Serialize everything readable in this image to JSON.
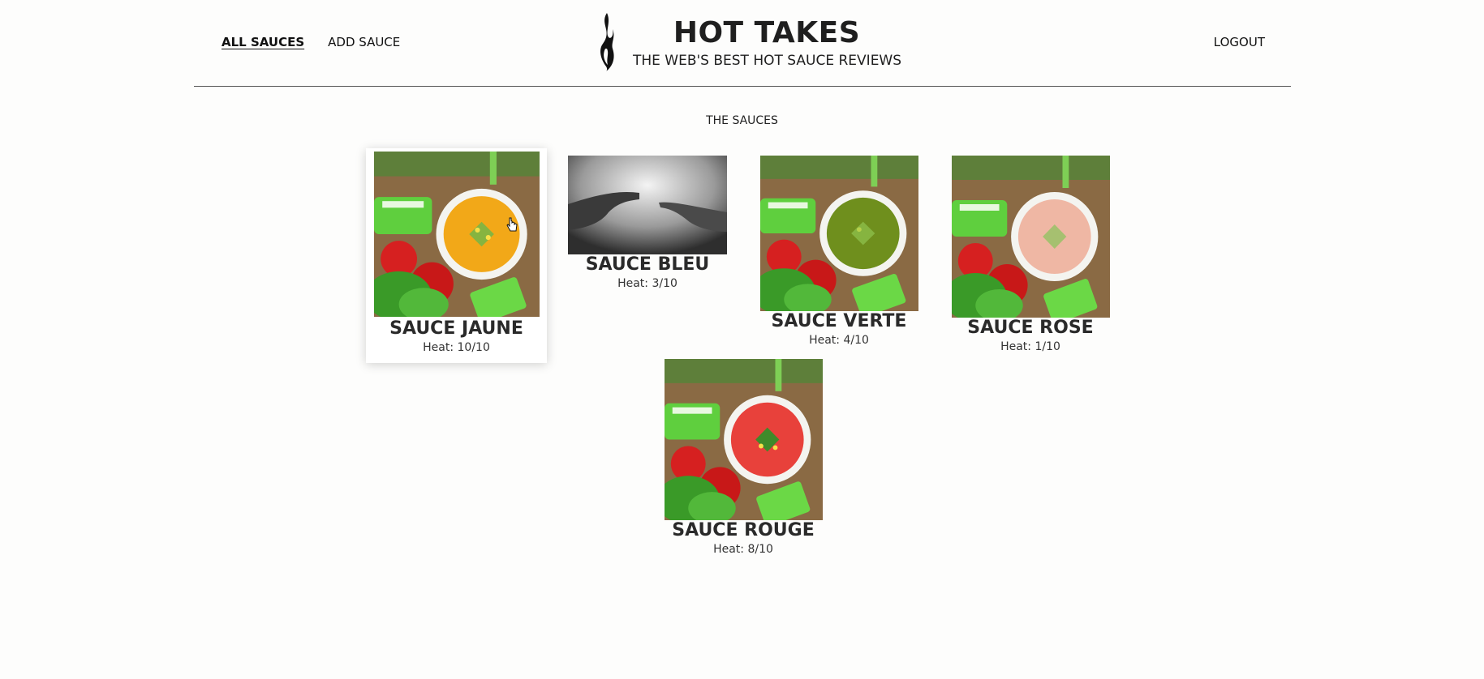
{
  "nav": {
    "all_sauces": "ALL SAUCES",
    "add_sauce": "ADD SAUCE",
    "logout": "LOGOUT"
  },
  "brand": {
    "title": "HOT TAKES",
    "tagline": "THE WEB'S BEST HOT SAUCE REVIEWS",
    "logo_icon": "flame-icon"
  },
  "section_title": "THE SAUCES",
  "sauces": [
    {
      "name": "SAUCE JAUNE",
      "heat": "Heat: 10/10",
      "image": "yellow-soup-bowl-photo",
      "color": "#f2a818"
    },
    {
      "name": "SAUCE BLEU",
      "heat": "Heat: 3/10",
      "image": "hands-reaching-bw-photo",
      "color": "#888888"
    },
    {
      "name": "SAUCE VERTE",
      "heat": "Heat: 4/10",
      "image": "green-soup-bowl-photo",
      "color": "#6f8f1d"
    },
    {
      "name": "SAUCE ROSE",
      "heat": "Heat: 1/10",
      "image": "pink-soup-bowl-photo",
      "color": "#efb7a4"
    },
    {
      "name": "SAUCE ROUGE",
      "heat": "Heat: 8/10",
      "image": "red-soup-bowl-photo",
      "color": "#e8413b"
    }
  ]
}
